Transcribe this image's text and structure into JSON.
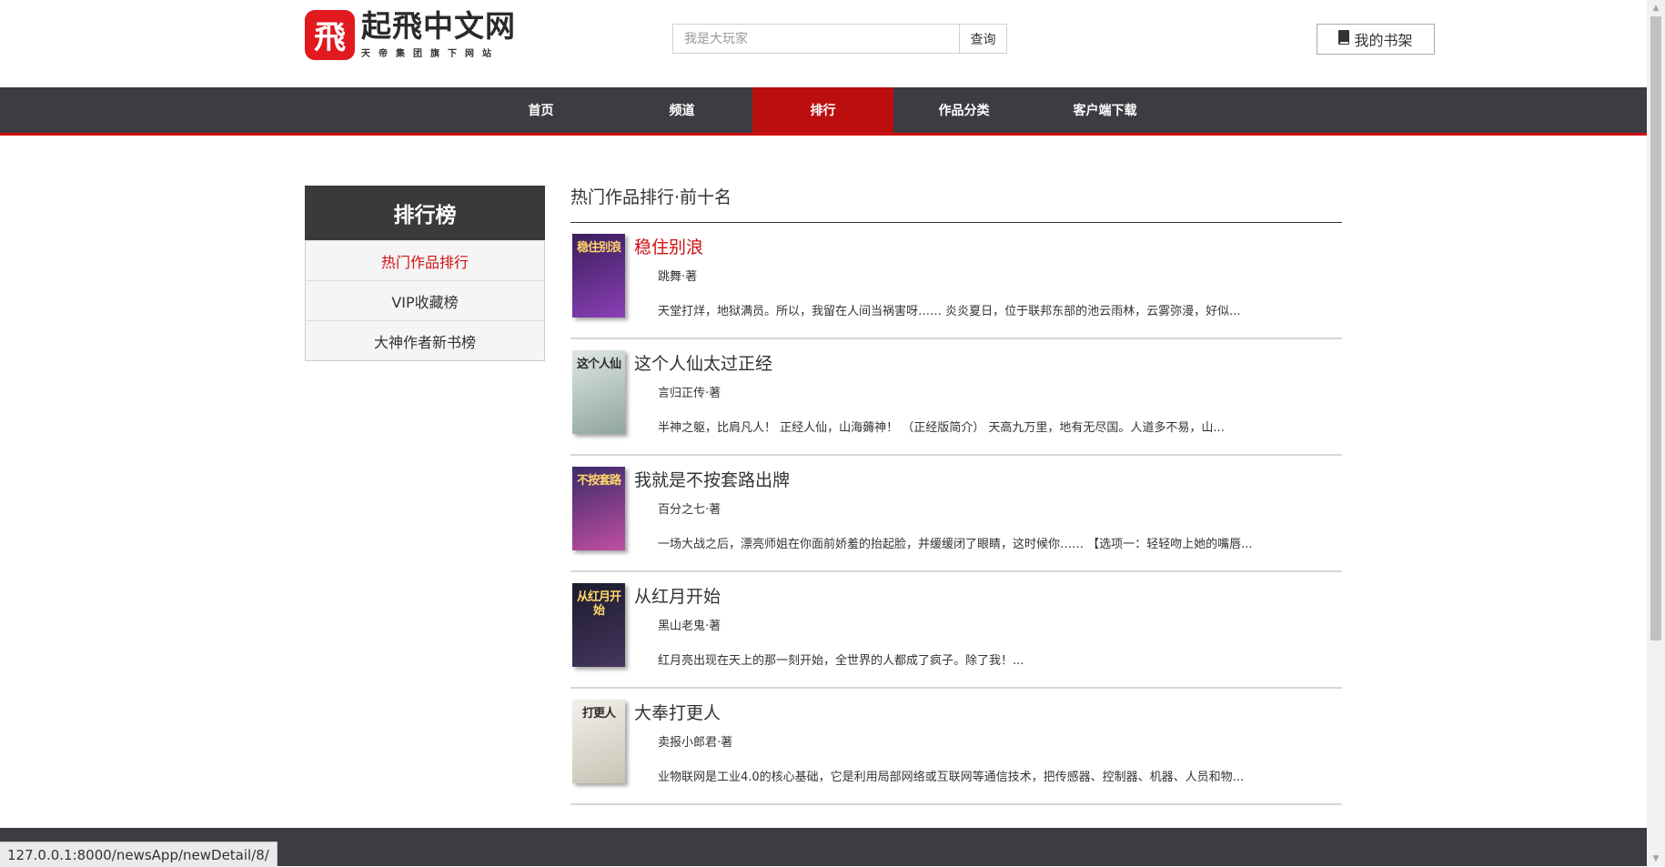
{
  "header": {
    "logo_glyph": "飛",
    "logo_title": "起飛中文网",
    "logo_subtitle": "天帝集团旗下网站",
    "search_placeholder": "我是大玩家",
    "search_button": "查询",
    "bookshelf_icon": "book-icon",
    "bookshelf_label": "我的书架"
  },
  "nav": {
    "items": [
      {
        "label": "首页"
      },
      {
        "label": "频道"
      },
      {
        "label": "排行",
        "active": true
      },
      {
        "label": "作品分类"
      },
      {
        "label": "客户端下载"
      }
    ]
  },
  "sidebar": {
    "title": "排行榜",
    "items": [
      {
        "label": "热门作品排行",
        "active": true
      },
      {
        "label": "VIP收藏榜"
      },
      {
        "label": "大神作者新书榜"
      }
    ]
  },
  "main": {
    "title": "热门作品排行·前十名",
    "books": [
      {
        "title": "稳住别浪",
        "author": "跳舞·著",
        "intro": "天堂打烊，地狱满员。所以，我留在人间当祸害呀…… 炎炎夏日，位于联邦东部的池云雨林，云雾弥漫，好似...",
        "cover_text": "稳住别浪",
        "cover_colors": [
          "#3a1e5c",
          "#8a3fb5"
        ]
      },
      {
        "title": "这个人仙太过正经",
        "author": "言归正传·著",
        "intro": "半神之躯，比肩凡人！ 正经人仙，山海薅神！ （正经版简介） 天高九万里，地有无尽国。人道多不易，山...",
        "cover_text": "这个人仙",
        "cover_colors": [
          "#dfe7e4",
          "#8fa59c"
        ]
      },
      {
        "title": "我就是不按套路出牌",
        "author": "百分之七·著",
        "intro": "一场大战之后，漂亮师姐在你面前娇羞的抬起脸，并缓缓闭了眼睛，这时候你…… 【选项一：轻轻吻上她的嘴唇...",
        "cover_text": "不按套路",
        "cover_colors": [
          "#3b2a6b",
          "#c04fa0"
        ]
      },
      {
        "title": "从红月开始",
        "author": "黑山老鬼·著",
        "intro": "红月亮出现在天上的那一刻开始，全世界的人都成了疯子。除了我！...",
        "cover_text": "从红月开始",
        "cover_colors": [
          "#1c1b2e",
          "#45365e"
        ]
      },
      {
        "title": "大奉打更人",
        "author": "卖报小郎君·著",
        "intro": "业物联网是工业4.0的核心基础，它是利用局部网络或互联网等通信技术，把传感器、控制器、机器、人员和物...",
        "cover_text": "打更人",
        "cover_colors": [
          "#f2f0ea",
          "#c8c3b5"
        ]
      }
    ]
  },
  "status_url": "127.0.0.1:8000/newsApp/newDetail/8/"
}
